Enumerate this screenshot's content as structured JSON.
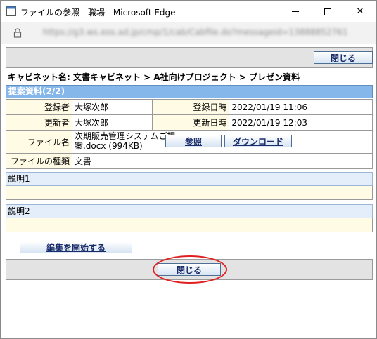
{
  "window": {
    "title": "ファイルの参照 - 職場 - Microsoft Edge",
    "minimize_glyph": "—",
    "maximize_glyph": "☐",
    "close_glyph": "✕"
  },
  "address": {
    "url": "https://g3.ws.eos.ad.jp/cmp/1/cab/Cabfile.do?messageid=13888852761"
  },
  "toolbar": {
    "close_label": "閉じる"
  },
  "breadcrumb": {
    "text": "キャビネット名: 文書キャビネット > A社向けプロジェクト > プレゼン資料"
  },
  "document": {
    "section_title": "提案資料(2/2)",
    "rows": {
      "registrant_label": "登録者",
      "registrant": "大塚次郎",
      "registered_label": "登録日時",
      "registered": "2022/01/19 11:06",
      "updater_label": "更新者",
      "updater": "大塚次郎",
      "updated_label": "更新日時",
      "updated": "2022/01/19 12:03",
      "filename_label": "ファイル名",
      "filename": "次期販売管理システムご提案.docx (994KB)",
      "filetype_label": "ファイルの種類",
      "filetype": "文書"
    },
    "browse_label": "参照",
    "download_label": "ダウンロード"
  },
  "descriptions": [
    {
      "label": "説明1",
      "body": ""
    },
    {
      "label": "説明2",
      "body": ""
    }
  ],
  "edit_button_label": "編集を開始する",
  "footer": {
    "close_label": "閉じる"
  },
  "colors": {
    "section_header": "#86b7ea",
    "label_cell": "#fffbe4",
    "button_text": "#1a2d6b",
    "highlight": "#e02020"
  }
}
